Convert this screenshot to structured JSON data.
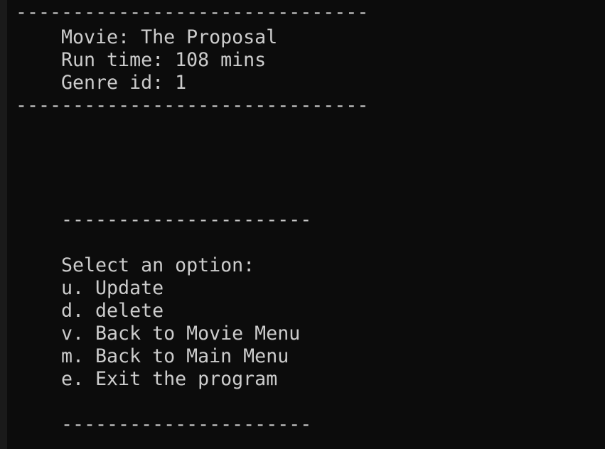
{
  "movie_details": {
    "top_rule": "-------------------------------",
    "movie_line": "Movie: The Proposal",
    "runtime_line": "Run time: 108 mins",
    "genre_line": "Genre id: 1",
    "bottom_rule": "-------------------------------"
  },
  "menu": {
    "top_rule": "----------------------",
    "prompt": "Select an option:",
    "options": [
      "u. Update",
      "d. delete",
      "v. Back to Movie Menu",
      "m. Back to Main Menu",
      "e. Exit the program"
    ],
    "bottom_rule": "----------------------"
  },
  "colors": {
    "background": "#0c0c0c",
    "text": "#cccccc"
  }
}
